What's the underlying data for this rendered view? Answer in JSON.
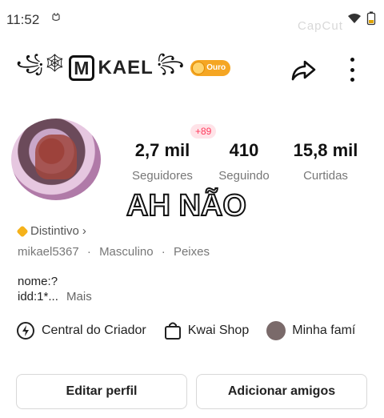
{
  "status_bar": {
    "time": "11:52",
    "notification_icon": "cat-icon"
  },
  "watermark": "CapCut",
  "profile": {
    "name_left_deco": "꧁🕸",
    "name_boxed": "M",
    "name_rest": "KAEL",
    "name_right_deco": "꧂",
    "badge_label": "Ouro"
  },
  "stats": {
    "new_followers": "+89",
    "followers_count": "2,7 mil",
    "followers_label": "Seguidores",
    "following_count": "410",
    "following_label": "Seguindo",
    "likes_count": "15,8 mil",
    "likes_label": "Curtidas"
  },
  "overlay_caption": "AH NÃO",
  "distintivo": {
    "label": "Distintivo",
    "chevron": "›"
  },
  "meta": {
    "username": "mikael5367",
    "gender": "Masculino",
    "sign": "Peixes",
    "separator": "·"
  },
  "bio": {
    "line1": "nome:?",
    "line2": "idd:1*...",
    "more": "Mais"
  },
  "shortcuts": [
    {
      "label": "Central do Criador",
      "icon": "bolt-circle-icon"
    },
    {
      "label": "Kwai Shop",
      "icon": "shopping-bag-icon"
    },
    {
      "label": "Minha famí",
      "icon": "family-avatar-icon"
    }
  ],
  "buttons": {
    "edit_profile": "Editar perfil",
    "add_friends": "Adicionar amigos"
  },
  "colors": {
    "badge": "#f5a623",
    "new_badge_text": "#ff3b5c",
    "new_badge_bg": "#ffe3e8"
  }
}
